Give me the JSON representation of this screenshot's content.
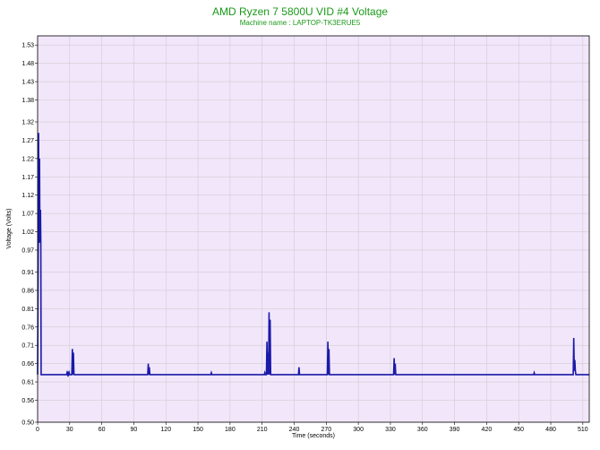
{
  "chart_data": {
    "type": "line",
    "title": "AMD Ryzen 7 5800U VID #4 Voltage",
    "subtitle": "Machine name : LAPTOP-TK3ERUE5",
    "xlabel": "Time (seconds)",
    "ylabel": "Voltage (Volts)",
    "xlim": [
      0,
      516
    ],
    "ylim": [
      0.5,
      1.555
    ],
    "x_ticks": [
      0,
      30,
      60,
      90,
      120,
      150,
      180,
      210,
      240,
      270,
      300,
      330,
      360,
      390,
      420,
      450,
      480,
      510
    ],
    "y_ticks": [
      0.5,
      0.56,
      0.61,
      0.66,
      0.71,
      0.76,
      0.81,
      0.86,
      0.91,
      0.97,
      1.02,
      1.07,
      1.12,
      1.17,
      1.22,
      1.27,
      1.32,
      1.38,
      1.43,
      1.48,
      1.53
    ],
    "grid": true,
    "colors": {
      "line": "#1a1aa8",
      "background": "#f2e6fa",
      "grid": "#c8c8c8",
      "title": "#1a9a1a"
    },
    "series": [
      {
        "name": "",
        "x": [
          0,
          0.6,
          0.9,
          1.2,
          1.5,
          1.8,
          2.1,
          2.4,
          2.7,
          3.0,
          3.3,
          3.6,
          4.0,
          4.5,
          27,
          27.5,
          28,
          28.5,
          29,
          29.5,
          30,
          31,
          32,
          32.5,
          33,
          33.5,
          34,
          103,
          103.5,
          104,
          104.5,
          105,
          162,
          162.5,
          163,
          212,
          212.5,
          213,
          214,
          214.5,
          215,
          215.5,
          216,
          216.5,
          217,
          217.5,
          218,
          218.5,
          244,
          244.5,
          245,
          245.5,
          271,
          271.5,
          272,
          272.5,
          273,
          333,
          333.5,
          334,
          334.5,
          335,
          464,
          464.5,
          465,
          501,
          501.5,
          502,
          502.5,
          503,
          503.5,
          504,
          516
        ],
        "y": [
          0.63,
          1.0,
          1.29,
          1.05,
          0.99,
          1.22,
          1.02,
          0.99,
          1.08,
          0.99,
          0.63,
          0.63,
          0.63,
          0.63,
          0.63,
          0.635,
          0.63,
          0.635,
          0.63,
          0.635,
          0.63,
          0.63,
          0.63,
          0.7,
          0.63,
          0.69,
          0.63,
          0.63,
          0.66,
          0.63,
          0.65,
          0.63,
          0.63,
          0.635,
          0.63,
          0.63,
          0.635,
          0.63,
          0.63,
          0.72,
          0.63,
          0.69,
          0.63,
          0.8,
          0.63,
          0.78,
          0.63,
          0.63,
          0.63,
          0.65,
          0.63,
          0.63,
          0.63,
          0.72,
          0.63,
          0.7,
          0.63,
          0.63,
          0.675,
          0.63,
          0.66,
          0.63,
          0.63,
          0.635,
          0.63,
          0.63,
          0.73,
          0.64,
          0.67,
          0.64,
          0.63,
          0.63,
          0.63
        ]
      }
    ]
  }
}
